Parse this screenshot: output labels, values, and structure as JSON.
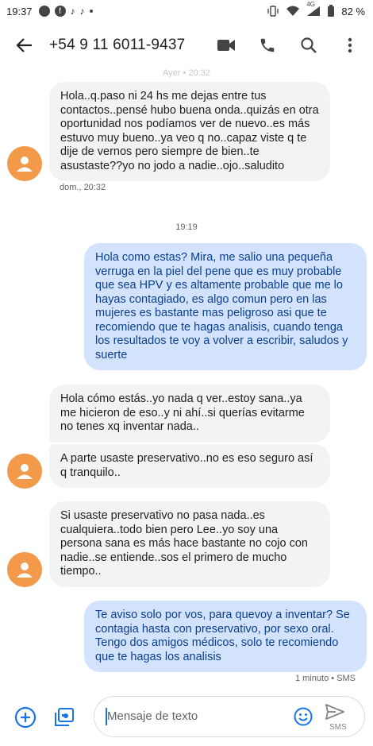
{
  "status_bar": {
    "time": "19:37",
    "network": "4G",
    "battery": "82 %"
  },
  "app_bar": {
    "contact": "+54 9 11 6011-9437"
  },
  "chat": {
    "top_label": "Ayer • 20:32",
    "messages": [
      {
        "direction": "in",
        "text": "Hola..q.paso ni 24 hs me dejas entre tus contactos..pensé hubo buena onda..quizás en otra oportunidad nos podíamos ver de nuevo..es más estuvo muy bueno..ya veo q no..capaz viste q te dije de vernos pero siempre de bien..te asustaste??yo no jodo a nadie..ojo..saludito",
        "meta": "dom., 20:32"
      },
      {
        "separator": "19:19"
      },
      {
        "direction": "out",
        "text": "Hola como estas? Mira, me salio una pequeña verruga en la piel del pene que es muy probable que sea HPV y es altamente probable que me lo hayas contagiado, es algo comun pero en las mujeres es bastante mas peligroso asi que te recomiendo que te hagas analisis, cuando tenga los resultados te voy a volver a escribir, saludos y suerte"
      },
      {
        "direction": "in",
        "text": "Hola cómo estás..yo nada q ver..estoy sana..ya me hicieron de eso..y ni ahí..si querías evitarme no tenes xq inventar nada.."
      },
      {
        "direction": "in",
        "text": "A parte usaste preservativo..no es eso seguro así q tranquilo.."
      },
      {
        "direction": "in",
        "text": "Si usaste preservativo no pasa nada..es cualquiera..todo bien pero Lee..yo soy una persona sana es más hace bastante no cojo con nadie..se entiende..sos el primero de mucho tiempo.."
      },
      {
        "direction": "out",
        "text": "Te aviso solo por vos, para quevoy a inventar? Se contagia hasta con preservativo, por sexo oral. Tengo dos amigos médicos, solo te recomiendo que te hagas los analisis",
        "meta": "1 minuto • SMS"
      }
    ]
  },
  "composer": {
    "placeholder": "Mensaje de texto",
    "send_label": "SMS"
  },
  "colors": {
    "incoming_bubble": "#f1f3f4",
    "outgoing_bubble": "#d3e3fd",
    "outgoing_text": "#0b3f8f",
    "avatar": "#f29a4a",
    "accent": "#1a73e8"
  }
}
